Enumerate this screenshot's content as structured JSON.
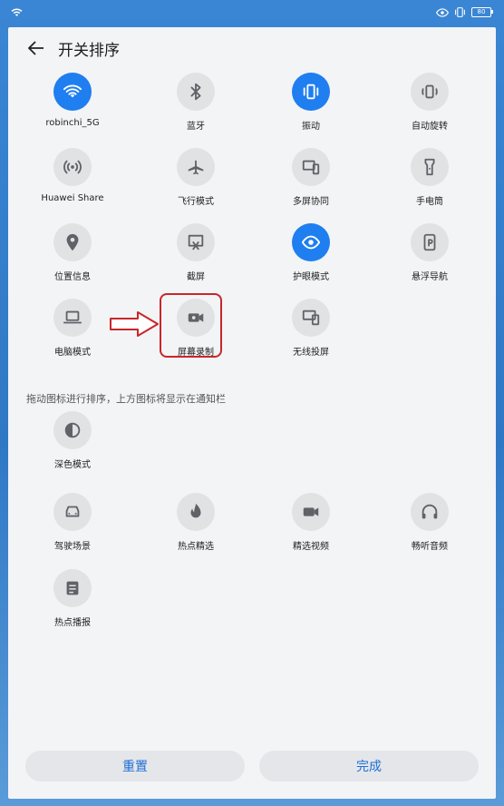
{
  "status_bar": {
    "wifi_icon": "wifi-icon",
    "right_icons": [
      "eye-comfort-icon",
      "vibrate-icon"
    ],
    "battery": "80"
  },
  "header": {
    "back_icon": "arrow-left-icon",
    "title": "开关排序"
  },
  "colors": {
    "active": "#1f7ef0",
    "inactive_circle": "#e1e2e4",
    "accent_text": "#1f6fd6",
    "annotation": "#c8262a"
  },
  "active_tiles": [
    {
      "label": "robinchi_5G",
      "icon": "wifi-icon",
      "active": true
    },
    {
      "label": "蓝牙",
      "icon": "bluetooth-icon",
      "active": false
    },
    {
      "label": "振动",
      "icon": "vibrate-icon",
      "active": true
    },
    {
      "label": "自动旋转",
      "icon": "rotate-icon",
      "active": false
    },
    {
      "label": "Huawei Share",
      "icon": "huawei-share-icon",
      "active": false
    },
    {
      "label": "飞行模式",
      "icon": "airplane-icon",
      "active": false
    },
    {
      "label": "多屏协同",
      "icon": "multi-screen-icon",
      "active": false
    },
    {
      "label": "手电筒",
      "icon": "flashlight-icon",
      "active": false
    },
    {
      "label": "位置信息",
      "icon": "location-icon",
      "active": false
    },
    {
      "label": "截屏",
      "icon": "screenshot-icon",
      "active": false
    },
    {
      "label": "护眼模式",
      "icon": "eye-icon",
      "active": true
    },
    {
      "label": "悬浮导航",
      "icon": "floating-nav-icon",
      "active": false
    },
    {
      "label": "电脑模式",
      "icon": "laptop-icon",
      "active": false
    },
    {
      "label": "屏幕录制",
      "icon": "screen-record-icon",
      "active": false
    },
    {
      "label": "无线投屏",
      "icon": "wireless-projection-icon",
      "active": false
    }
  ],
  "hint": "拖动图标进行排序，上方图标将显示在通知栏",
  "inactive_tiles": [
    {
      "label": "深色模式",
      "icon": "dark-mode-icon"
    },
    {
      "label": "驾驶场景",
      "icon": "car-icon"
    },
    {
      "label": "热点精选",
      "icon": "flame-icon"
    },
    {
      "label": "精选视频",
      "icon": "video-camera-icon"
    },
    {
      "label": "畅听音频",
      "icon": "headphones-icon"
    },
    {
      "label": "热点播报",
      "icon": "news-icon"
    }
  ],
  "buttons": {
    "reset": "重置",
    "done": "完成"
  }
}
